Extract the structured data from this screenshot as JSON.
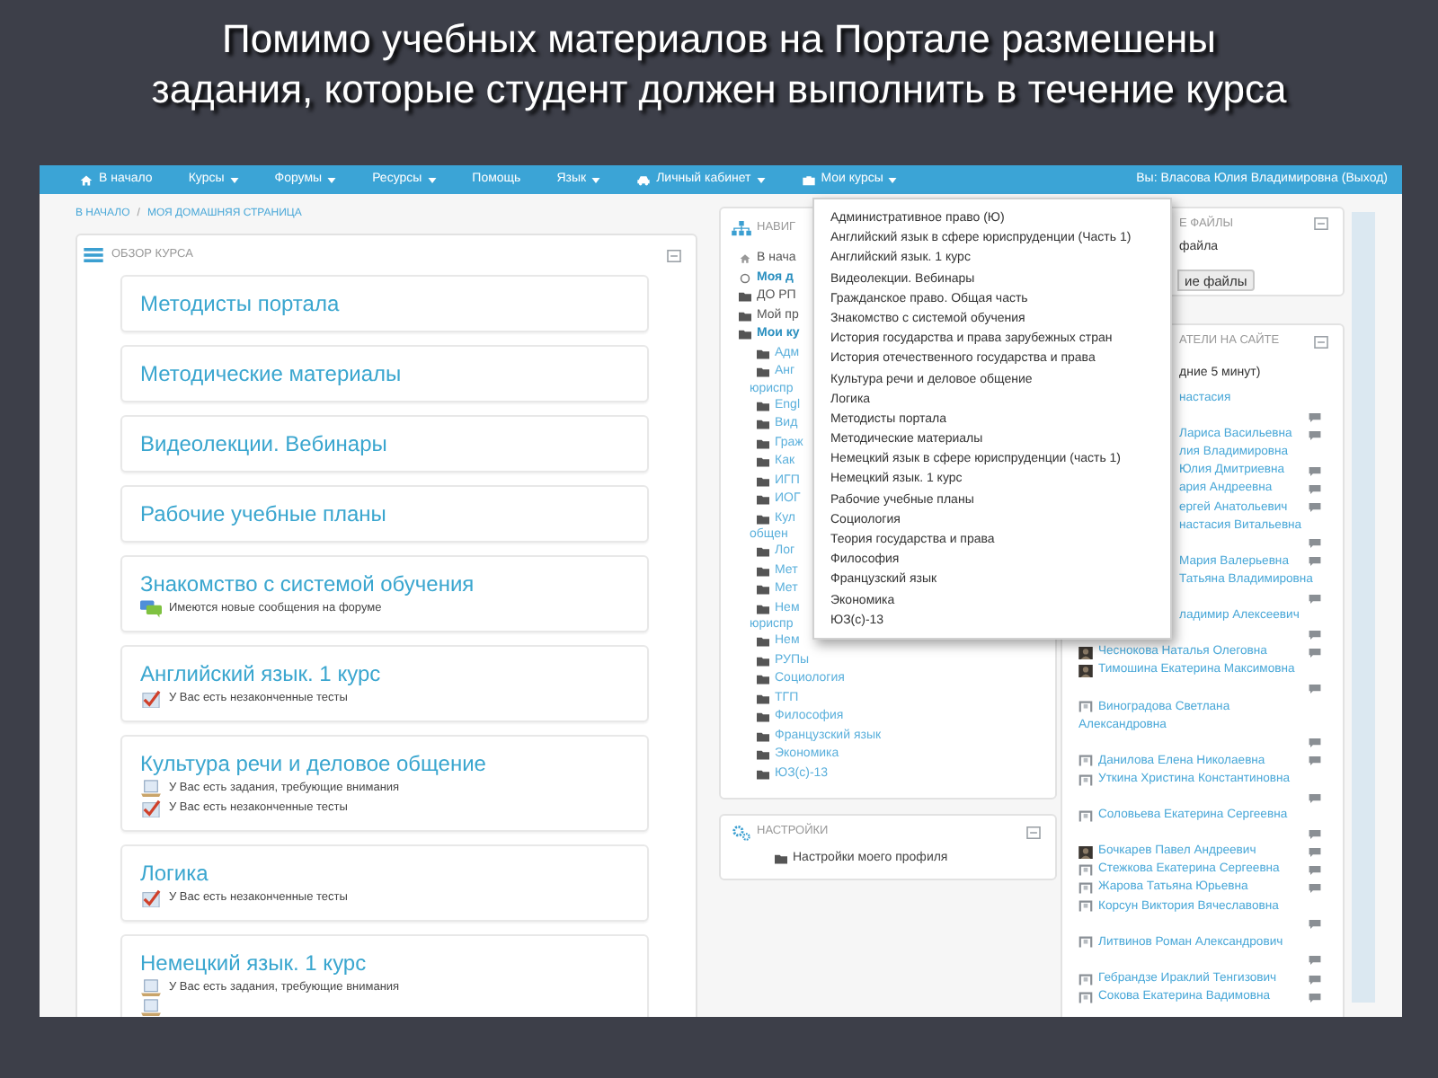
{
  "slide": {
    "title": "Помимо учебных материалов на Портале размешены задания, которые студент должен выполнить в течение курса"
  },
  "navbar": {
    "items": [
      {
        "kind": "home",
        "label": "В начало",
        "caret": false
      },
      {
        "kind": "plain",
        "label": "Курсы",
        "caret": true
      },
      {
        "kind": "plain",
        "label": "Форумы",
        "caret": true
      },
      {
        "kind": "plain",
        "label": "Ресурсы",
        "caret": true
      },
      {
        "kind": "plain",
        "label": "Помощь",
        "caret": false
      },
      {
        "kind": "plain",
        "label": "Язык",
        "caret": true
      },
      {
        "kind": "cabinet",
        "label": "Личный кабинет",
        "caret": true
      },
      {
        "kind": "courses",
        "label": "Мои курсы",
        "caret": true
      }
    ],
    "user": "Вы: Власова Юлия Владимировна (Выход)"
  },
  "breadcrumb": {
    "items": [
      "В НАЧАЛО",
      "МОЯ ДОМАШНЯЯ СТРАНИЦА"
    ],
    "separator": "/"
  },
  "course_overview": {
    "title": "ОБЗОР КУРСА",
    "courses": [
      {
        "title": "Методисты портала"
      },
      {
        "title": "Методические материалы"
      },
      {
        "title": "Видеолекции. Вебинары"
      },
      {
        "title": "Рабочие учебные планы"
      },
      {
        "title": "Знакомство с системой обучения",
        "notices": [
          {
            "kind": "forum",
            "text": "Имеются новые сообщения на форуме"
          }
        ]
      },
      {
        "title": "Английский язык. 1 курс",
        "notices": [
          {
            "kind": "quiz",
            "text": "У Вас есть незаконченные тесты"
          }
        ]
      },
      {
        "title": "Культура речи и деловое общение",
        "notices": [
          {
            "kind": "assignment",
            "text": "У Вас есть задания, требующие внимания"
          },
          {
            "kind": "quiz",
            "text": "У Вас есть незаконченные тесты"
          }
        ]
      },
      {
        "title": "Логика",
        "notices": [
          {
            "kind": "quiz",
            "text": "У Вас есть незаконченные тесты"
          }
        ]
      },
      {
        "title": "Немецкий язык. 1 курс",
        "notices": [
          {
            "kind": "assignment",
            "text": "У Вас есть задания, требующие внимания"
          },
          {
            "kind": "assignment"
          }
        ]
      }
    ]
  },
  "navigation": {
    "title": "НАВИГ",
    "items": [
      {
        "kind": "home",
        "label": "В нача",
        "bold": false
      },
      {
        "kind": "page",
        "label": "Моя д",
        "bold": true
      },
      {
        "kind": "folder",
        "label": "ДО РП",
        "bold": false
      },
      {
        "kind": "folder",
        "label": "Мой пр",
        "bold": false
      },
      {
        "kind": "folder",
        "label": "Мои ку",
        "bold": true,
        "children": [
          {
            "label": "Адм"
          },
          {
            "label": "Анг",
            "label_2": "юриспр"
          },
          {
            "label": "Engl"
          },
          {
            "label": "Вид"
          },
          {
            "label": "Граж"
          },
          {
            "label": "Как"
          },
          {
            "label": "ИГП"
          },
          {
            "label": "ИОГ"
          },
          {
            "label": "Кул",
            "label_2": "общен"
          },
          {
            "label": "Лог"
          },
          {
            "label": "Мет"
          },
          {
            "label": "Мет"
          },
          {
            "label": "Нем",
            "label_2": "юриспр"
          },
          {
            "label": "Нем"
          },
          {
            "label": "РУПы"
          },
          {
            "label": "Социология"
          },
          {
            "label": "ТГП"
          },
          {
            "label": "Философия"
          },
          {
            "label": "Французский язык"
          },
          {
            "label": "Экономика"
          },
          {
            "label": "ЮЗ(с)-13"
          }
        ]
      }
    ]
  },
  "settings": {
    "title": "НАСТРОЙКИ",
    "items": [
      "Настройки моего профиля"
    ]
  },
  "my_courses_menu": {
    "items": [
      "Административное право (Ю)",
      "Английский язык в сфере юриспруденции (Часть 1)",
      "Английский язык. 1 курс",
      "Видеолекции. Вебинары",
      "Гражданское право. Общая часть",
      "Знакомство с системой обучения",
      "История государства и права зарубежных стран",
      "История отечественного государства и права",
      "Культура речи и деловое общение",
      "Логика",
      "Методисты портала",
      "Методические материалы",
      "Немецкий язык в сфере юриспруденции (часть 1)",
      "Немецкий язык. 1 курс",
      "Рабочие учебные планы",
      "Социология",
      "Теория государства и права",
      "Философия",
      "Французский язык",
      "Экономика",
      "ЮЗ(с)-13"
    ]
  },
  "private_files": {
    "title": "Е ФАЙЛЫ",
    "text": "файла",
    "button": "ие файлы"
  },
  "online_users": {
    "title": "АТЕЛИ НА САЙТЕ",
    "subtitle": "дние 5 минут)",
    "lines": [
      {
        "kind": "partial",
        "name": "настасия"
      },
      {
        "kind": "partial",
        "chat": true
      },
      {
        "kind": "partial",
        "name": "Лариса Васильевна",
        "chat": true
      },
      {
        "kind": "partial",
        "name": "лия Владимировна"
      },
      {
        "kind": "partial",
        "name": "Юлия Дмитриевна",
        "chat": true
      },
      {
        "kind": "partial",
        "name": "ария Андреевна",
        "chat": true
      },
      {
        "kind": "partial",
        "name": "ергей Анатольевич",
        "chat": true
      },
      {
        "kind": "partial",
        "name": "настасия Витальевна"
      },
      {
        "kind": "partial",
        "chat": true
      },
      {
        "kind": "partial",
        "name": "Мария Валерьевна",
        "chat": true
      },
      {
        "kind": "partial",
        "name": "Татьяна Владимировна"
      },
      {
        "kind": "partial",
        "chat": true
      },
      {
        "kind": "partial",
        "name": "ладимир Алексеевич"
      },
      {
        "kind": "partial",
        "chat": true
      },
      {
        "kind": "photo",
        "name": "Чеснокова Наталья Олеговна",
        "chat": true
      },
      {
        "kind": "photo",
        "name": "Тимошина Екатерина Максимовна"
      },
      {
        "kind": "plain",
        "chat": true
      },
      {
        "kind": "user",
        "name": "Виноградова Светлана"
      },
      {
        "kind": "plain",
        "name": "Александровна"
      },
      {
        "kind": "plain",
        "chat": true
      },
      {
        "kind": "user",
        "name": "Данилова Елена Николаевна",
        "chat": true
      },
      {
        "kind": "user",
        "name": "Уткина Христина Константиновна"
      },
      {
        "kind": "plain",
        "chat": true
      },
      {
        "kind": "user",
        "name": "Соловьева Екатерина Сергеевна"
      },
      {
        "kind": "plain",
        "chat": true
      },
      {
        "kind": "photo",
        "name": "Бочкарев Павел Андреевич",
        "chat": true
      },
      {
        "kind": "user",
        "name": "Стежкова Екатерина Сергеевна",
        "chat": true
      },
      {
        "kind": "user",
        "name": "Жарова Татьяна Юрьевна",
        "chat": true
      },
      {
        "kind": "user",
        "name": "Корсун Виктория Вячеславовна"
      },
      {
        "kind": "plain",
        "chat": true
      },
      {
        "kind": "user",
        "name": "Литвинов Роман Александрович"
      },
      {
        "kind": "plain",
        "chat": true
      },
      {
        "kind": "user",
        "name": "Гебрандзе Ираклий Тенгизович",
        "chat": true
      },
      {
        "kind": "user",
        "name": "Сокова Екатерина Вадимовна",
        "chat": true
      }
    ]
  }
}
